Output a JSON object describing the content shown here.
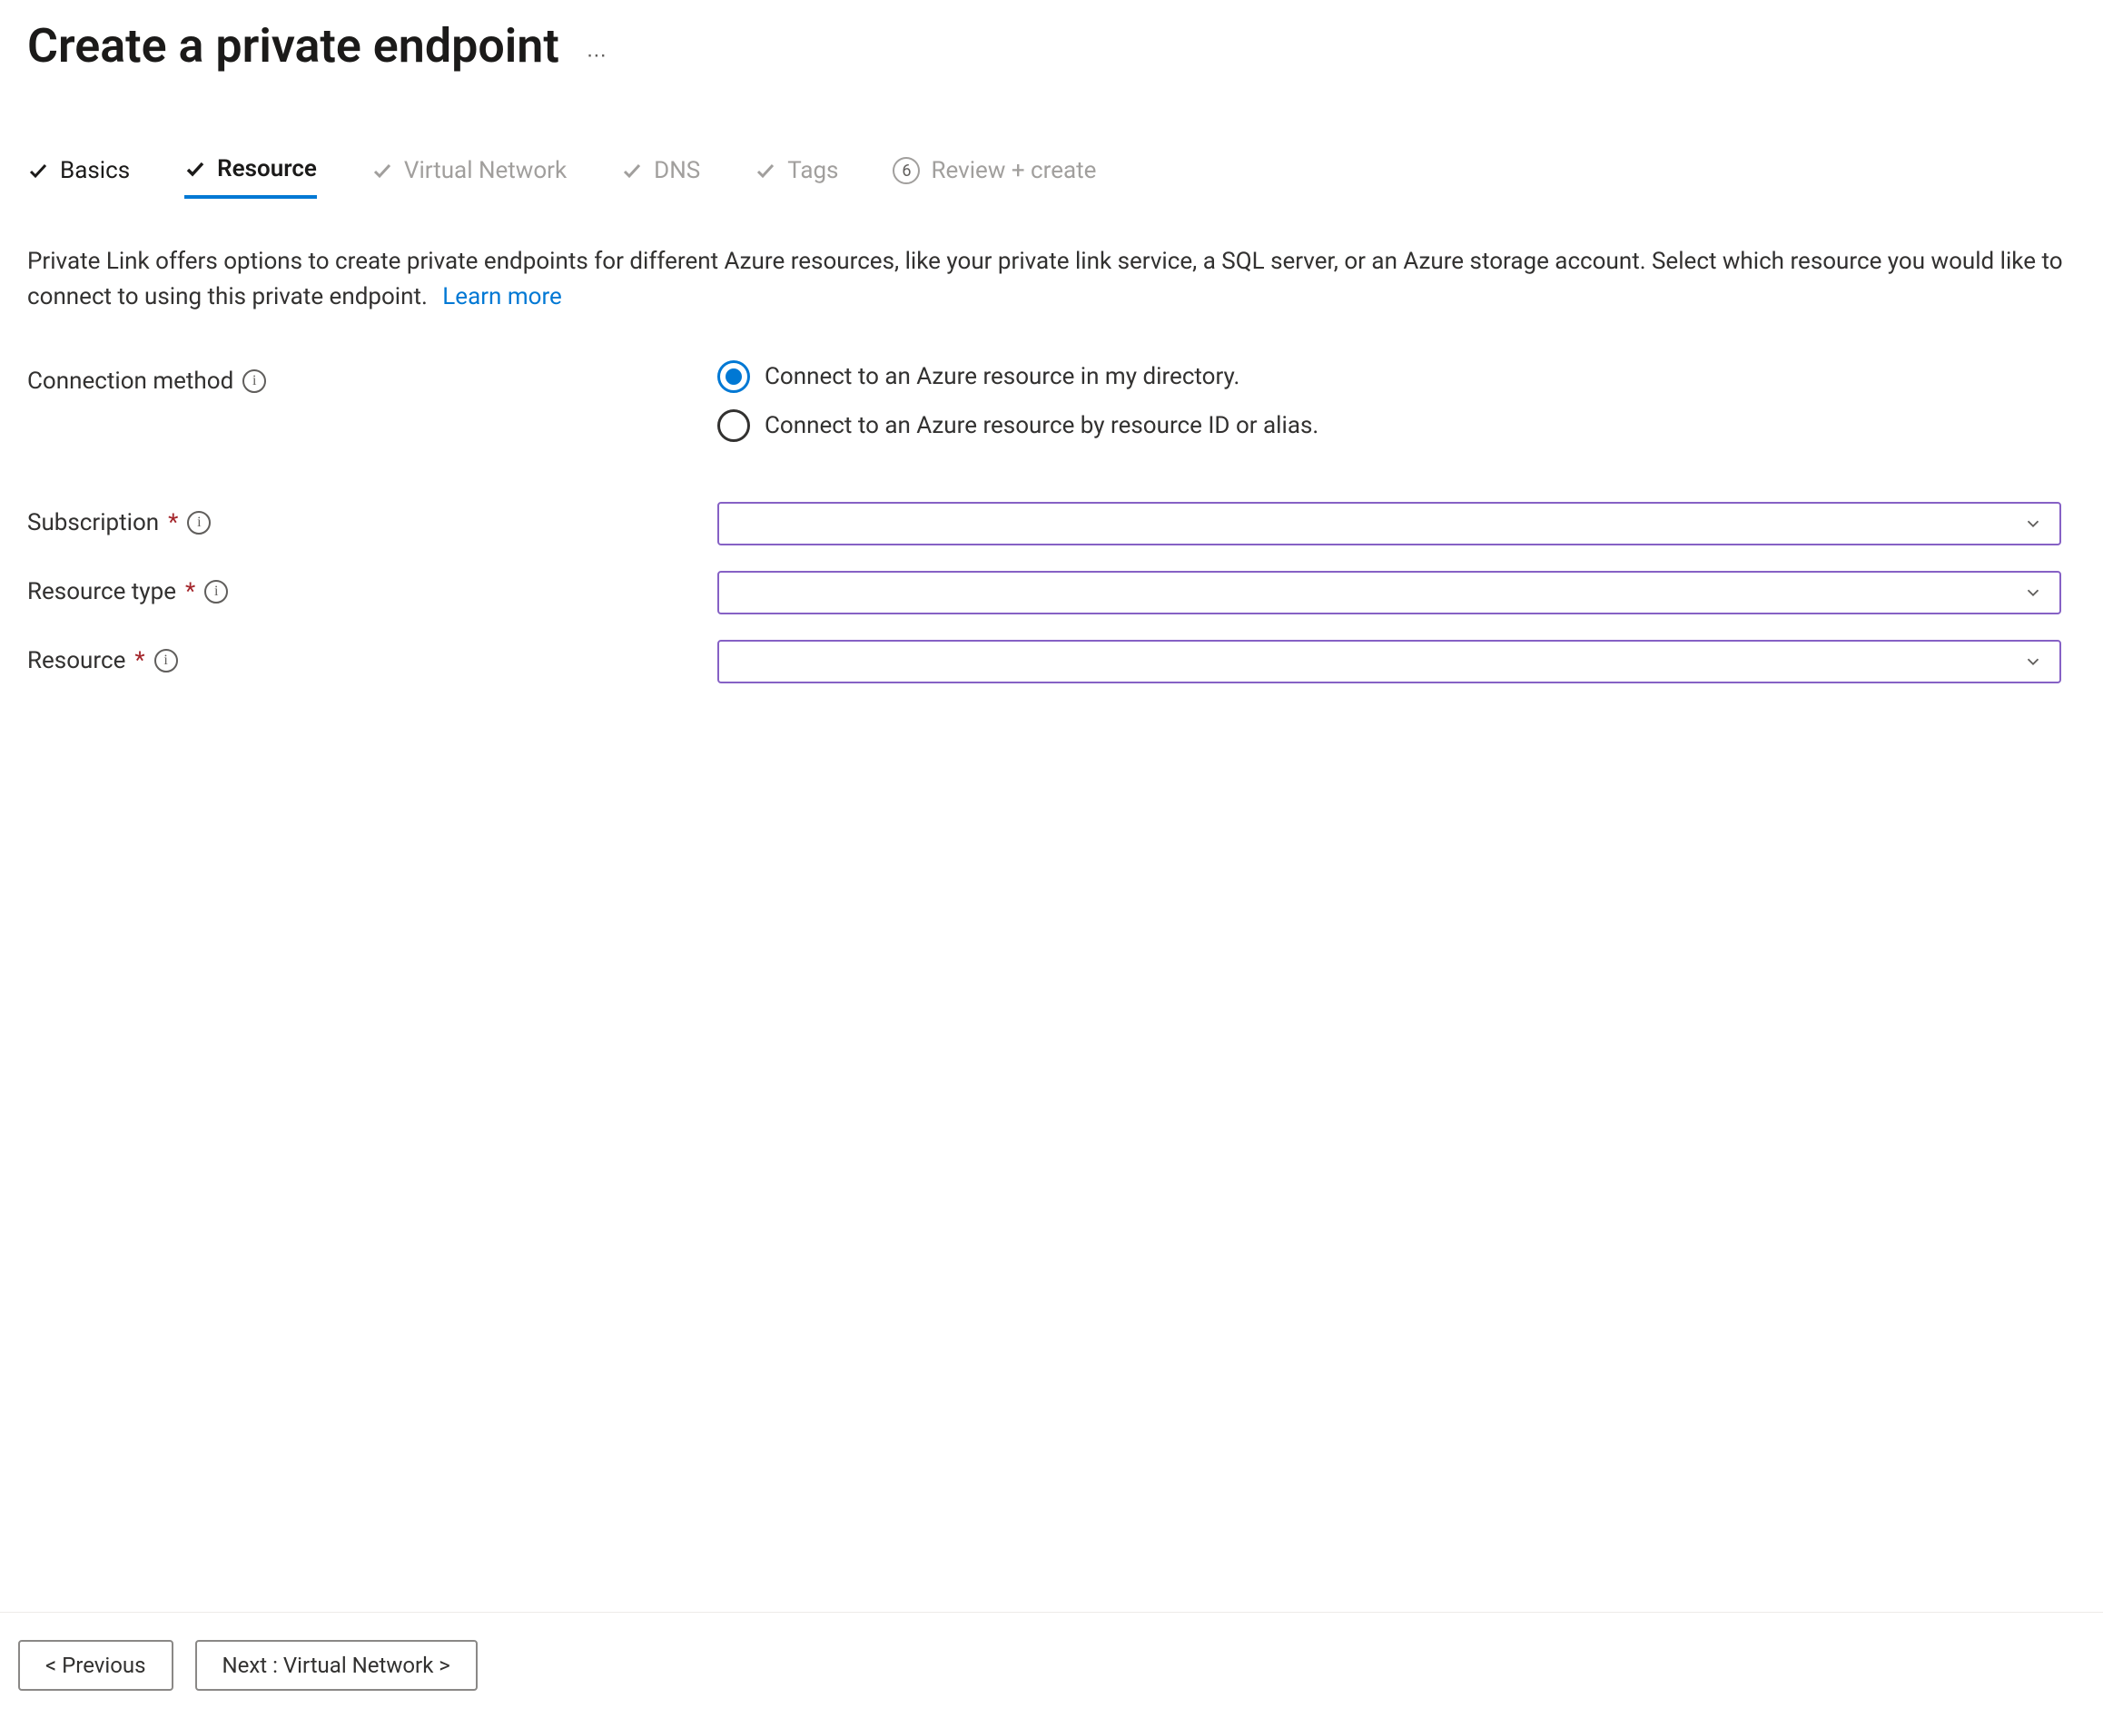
{
  "header": {
    "title": "Create a private endpoint"
  },
  "tabs": [
    {
      "label": "Basics",
      "state": "completed"
    },
    {
      "label": "Resource",
      "state": "active"
    },
    {
      "label": "Virtual Network",
      "state": "pending"
    },
    {
      "label": "DNS",
      "state": "pending"
    },
    {
      "label": "Tags",
      "state": "pending"
    },
    {
      "label": "Review + create",
      "state": "numbered",
      "number": "6"
    }
  ],
  "description": {
    "text": "Private Link offers options to create private endpoints for different Azure resources, like your private link service, a SQL server, or an Azure storage account. Select which resource you would like to connect to using this private endpoint.",
    "learn_more": "Learn more"
  },
  "fields": {
    "connection_method": {
      "label": "Connection method",
      "options": [
        {
          "label": "Connect to an Azure resource in my directory.",
          "selected": true
        },
        {
          "label": "Connect to an Azure resource by resource ID or alias.",
          "selected": false
        }
      ]
    },
    "subscription": {
      "label": "Subscription",
      "value": ""
    },
    "resource_type": {
      "label": "Resource type",
      "value": ""
    },
    "resource": {
      "label": "Resource",
      "value": ""
    }
  },
  "footer": {
    "previous": "< Previous",
    "next": "Next : Virtual Network >"
  }
}
